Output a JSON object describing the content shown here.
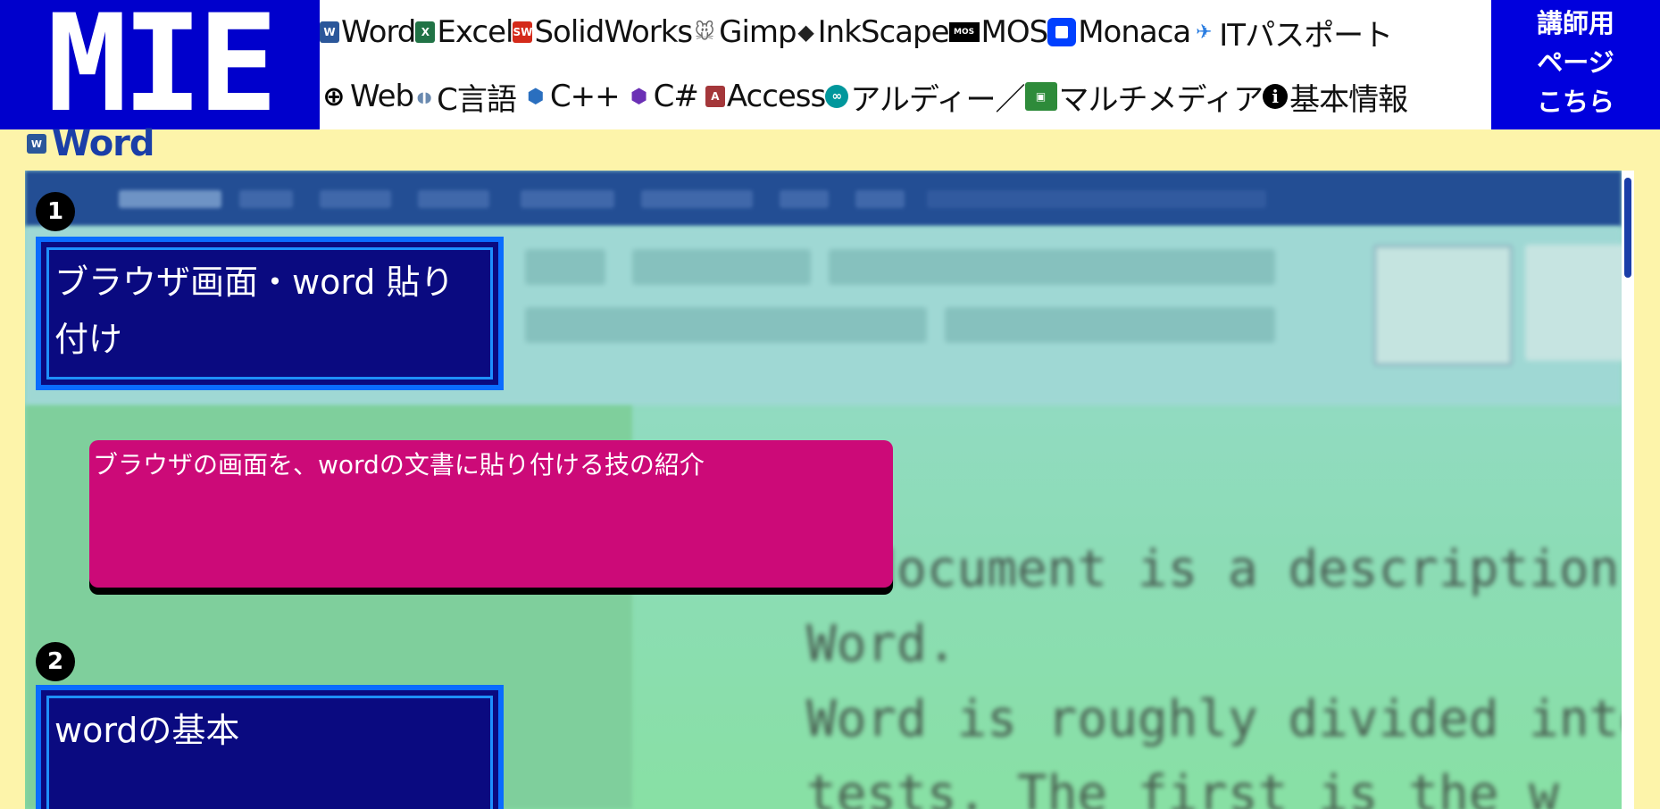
{
  "header": {
    "logo_text": "MIE",
    "nav_row1": [
      {
        "label": "Word",
        "icon": "word-icon",
        "glyph": "W"
      },
      {
        "label": "Excel",
        "icon": "excel-icon",
        "glyph": "X"
      },
      {
        "label": "SolidWorks",
        "icon": "solidworks-icon",
        "glyph": "SW"
      },
      {
        "label": "Gimp",
        "icon": "gimp-icon",
        "glyph": "🐭"
      },
      {
        "label": "InkScape",
        "icon": "inkscape-icon",
        "glyph": "◆"
      },
      {
        "label": "MOS",
        "icon": "mos-icon",
        "glyph": "MOS"
      },
      {
        "label": "Monaca",
        "icon": "monaca-icon",
        "glyph": ""
      },
      {
        "label": "ITパスポート",
        "icon": "it-passport-icon",
        "glyph": "✈"
      }
    ],
    "nav_row2": [
      {
        "label": "Web",
        "icon": "globe-icon",
        "glyph": "⊕"
      },
      {
        "label": "C言語",
        "icon": "c-language-icon",
        "glyph": "◖◗"
      },
      {
        "label": "C++",
        "icon": "cpp-icon",
        "glyph": "⬢"
      },
      {
        "label": "C#",
        "icon": "csharp-icon",
        "glyph": "⬢"
      },
      {
        "label": "Access",
        "icon": "access-icon",
        "glyph": "A"
      },
      {
        "label": "アルディー／",
        "icon": "arduino-icon",
        "glyph": "∞"
      },
      {
        "label": "マルチメディア",
        "icon": "multimedia-icon",
        "glyph": "▣"
      },
      {
        "label": "基本情報",
        "icon": "info-icon",
        "glyph": "i"
      }
    ],
    "teacher_lines": [
      "講師用",
      "ページ",
      "こちら"
    ]
  },
  "section": {
    "title": "Word",
    "icon": "word-icon",
    "glyph": "W"
  },
  "background_doc": {
    "lines": [
      "s document is a description",
      "Word.",
      "Word is roughly divided into",
      "tests. The first is the w"
    ]
  },
  "items": [
    {
      "number": "1",
      "title": "ブラウザ画面・word 貼り付け",
      "description": "ブラウザの画面を、wordの文書に貼り付ける技の紹介"
    },
    {
      "number": "2",
      "title": "wordの基本"
    }
  ],
  "colors": {
    "background": "#fdf4aa",
    "logo": "#0000cc",
    "card_title": "#0a0a80",
    "card_border": "#0a6cff",
    "description": "#cc0a78",
    "heading": "#1a3ea8"
  }
}
